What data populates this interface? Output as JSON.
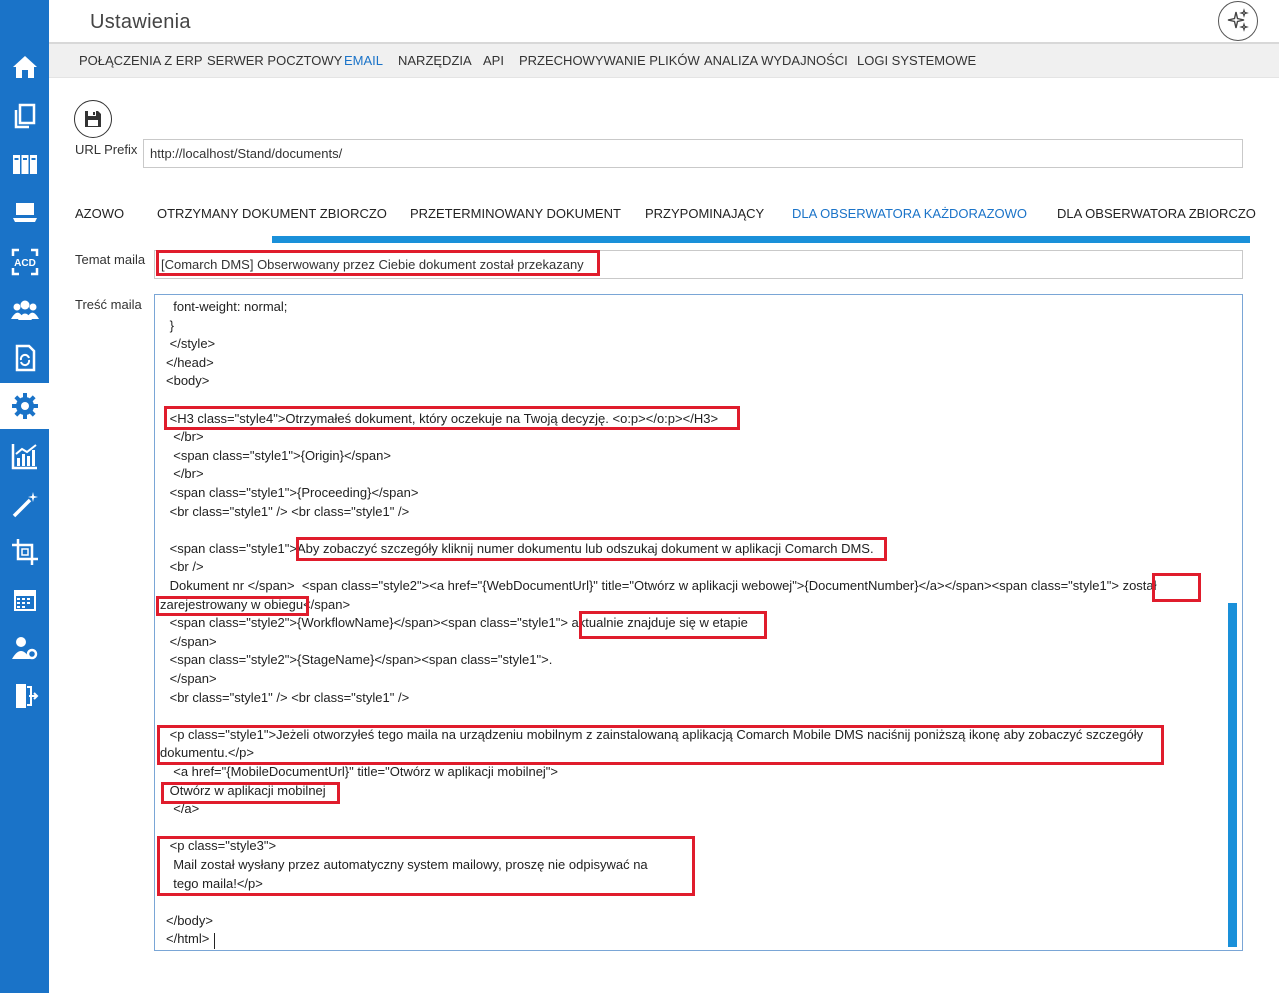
{
  "header": {
    "title": "Ustawienia"
  },
  "sidebar": {
    "items": [
      {
        "icon": "home-icon"
      },
      {
        "icon": "documents-icon"
      },
      {
        "icon": "binders-icon"
      },
      {
        "icon": "laptop-icon"
      },
      {
        "icon": "acd-scan-icon",
        "text": "ACD"
      },
      {
        "icon": "users-group-icon"
      },
      {
        "icon": "document-sync-icon"
      },
      {
        "icon": "gear-icon"
      },
      {
        "icon": "chart-icon"
      },
      {
        "icon": "magic-wand-icon"
      },
      {
        "icon": "crop-icon"
      },
      {
        "icon": "calendar-icon"
      },
      {
        "icon": "user-settings-icon"
      },
      {
        "icon": "logout-door-icon"
      }
    ]
  },
  "nav": {
    "items": [
      {
        "label": "POŁĄCZENIA Z ERP"
      },
      {
        "label": "SERWER POCZTOWY"
      },
      {
        "label": "EMAIL"
      },
      {
        "label": "NARZĘDZIA"
      },
      {
        "label": "API"
      },
      {
        "label": "PRZECHOWYWANIE PLIKÓW"
      },
      {
        "label": "ANALIZA WYDAJNOŚCI"
      },
      {
        "label": "LOGI SYSTEMOWE"
      }
    ]
  },
  "url": {
    "label": "URL Prefix",
    "value": "http://localhost/Stand/documents/"
  },
  "tabs": [
    {
      "label": "AZOWO"
    },
    {
      "label": "OTRZYMANY DOKUMENT ZBIORCZO"
    },
    {
      "label": "PRZETERMINOWANY DOKUMENT"
    },
    {
      "label": "PRZYPOMINAJĄCY"
    },
    {
      "label": "DLA OBSERWATORA KAŻDORAZOWO"
    },
    {
      "label": "DLA OBSERWATORA ZBIORCZO"
    }
  ],
  "subject": {
    "label": "Temat maila",
    "value": "[Comarch DMS] Obserwowany przez Ciebie dokument został przekazany"
  },
  "body": {
    "label": "Treść maila",
    "lines": [
      "  font-weight: normal;",
      " }",
      " </style>",
      "</head>",
      "<body>",
      "",
      " <H3 class=\"style4\">Otrzymałeś dokument, który oczekuje na Twoją decyzję. <o:p></o:p></H3>",
      "  </br>",
      "  <span class=\"style1\">{Origin}</span>",
      "  </br>",
      " <span class=\"style1\">{Proceeding}</span>",
      " <br class=\"style1\" /> <br class=\"style1\" />",
      "",
      " <span class=\"style1\">Aby zobaczyć szczegóły kliknij numer dokumentu lub odszukaj dokument w aplikacji Comarch DMS.",
      " <br />",
      " Dokument nr </span>  <span class=\"style2\"><a href=\"{WebDocumentUrl}\" title=\"Otwórz w aplikacji webowej\">{DocumentNumber}</a></span><span class=\"style1\"> został",
      "zarejestrowany w obiegu</span>",
      " <span class=\"style2\">{WorkflowName}</span><span class=\"style1\"> aktualnie znajduje się w etapie",
      " </span>",
      " <span class=\"style2\">{StageName}</span><span class=\"style1\">.",
      " </span>",
      " <br class=\"style1\" /> <br class=\"style1\" />",
      "",
      " <p class=\"style1\">Jeżeli otworzyłeś tego maila na urządzeniu mobilnym z zainstalowaną aplikacją Comarch Mobile DMS naciśnij poniższą ikonę aby zobaczyć szczegóły",
      "dokumentu.</p>",
      "  <a href=\"{MobileDocumentUrl}\" title=\"Otwórz w aplikacji mobilnej\">",
      " Otwórz w aplikacji mobilnej",
      "  </a>",
      "",
      " <p class=\"style3\">",
      "  Mail został wysłany przez automatyczny system mailowy, proszę nie odpisywać na",
      "  tego maila!</p>",
      "",
      "</body>",
      "</html>"
    ]
  },
  "colors": {
    "sidebar": "#1a73c8",
    "accent": "#1a73c8",
    "highlight": "#e01c2c"
  }
}
